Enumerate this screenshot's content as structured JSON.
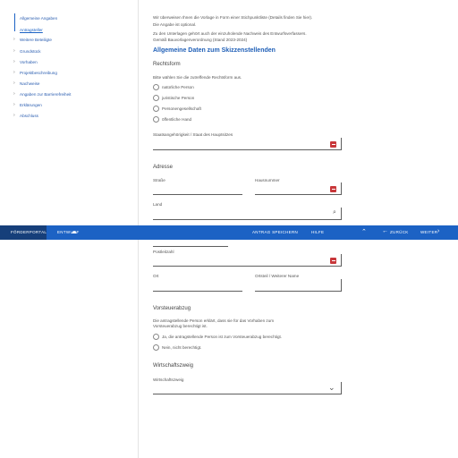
{
  "sidebar": {
    "items": [
      {
        "label": "Allgemeine Angaben",
        "active": false
      },
      {
        "label": "Antragsteller",
        "active": true
      },
      {
        "label": "Weitere Beteiligte",
        "active": false
      },
      {
        "label": "Grundstück",
        "active": false
      },
      {
        "label": "Vorhaben",
        "active": false
      },
      {
        "label": "Projektbeschreibung",
        "active": false
      },
      {
        "label": "Nachweise",
        "active": false
      },
      {
        "label": "Angaben zur Barrierefreiheit",
        "active": false
      },
      {
        "label": "Erklärungen",
        "active": false
      },
      {
        "label": "Abschluss",
        "active": false
      }
    ]
  },
  "intro": {
    "line1": "Wir überweisen Ihnen die Vorlage in Form einer Stichpunktliste (Details finden Sie hier).",
    "line2": "Die Angabe ist optional.",
    "line3": "Zu den Unterlagen gehört auch der einzuholende Nachweis des Entwurfsverfassers.",
    "line4": "Gemäß Bauvorlagenverordnung (Stand 2023-2024)"
  },
  "main": {
    "title": "Allgemeine Daten zum Skizzenstellenden",
    "rechtsform": {
      "heading": "Rechtsform",
      "hint": "Bitte wählen Sie die zutreffende Rechtsform aus.",
      "options": [
        "natürliche Person",
        "juristische Person",
        "Personengesellschaft",
        "öffentliche Hand"
      ]
    },
    "select_label": "Staatsangehörigkeit / Staat des Hauptsitzes",
    "adresse": {
      "heading": "Adresse",
      "strasse": "Straße",
      "hausnummer": "Hausnummer",
      "land": "Land",
      "postleitzahl": "Postleitzahl",
      "ort": "Ort",
      "ortsteil": "Ortsteil / Weiterer Name"
    },
    "vorsteuer": {
      "heading": "Vorsteuerabzug",
      "text1": "Die antragstellende Person erklärt, dass sie für das Vorhaben zum",
      "text2": "Vorsteuerabzug berechtigt ist.",
      "options": [
        "Ja, die antragstellende Person ist zum Vorsteuerabzug berechtigt.",
        "Nein, nicht berechtigt."
      ]
    },
    "wirtschaft": {
      "heading": "Wirtschaftszweig",
      "label": "Wirtschaftszweig"
    }
  },
  "topbar": {
    "app_label": "FÖRDERPORTAL",
    "badge": "ENTWURF",
    "action1": "ANTRAG SPEICHERN",
    "action2": "HILFE",
    "back": "ZURÜCK",
    "next": "WEITER"
  },
  "colors": {
    "accent": "#1c62c4",
    "accent_dark": "#163f7a",
    "error": "#c8373a"
  }
}
